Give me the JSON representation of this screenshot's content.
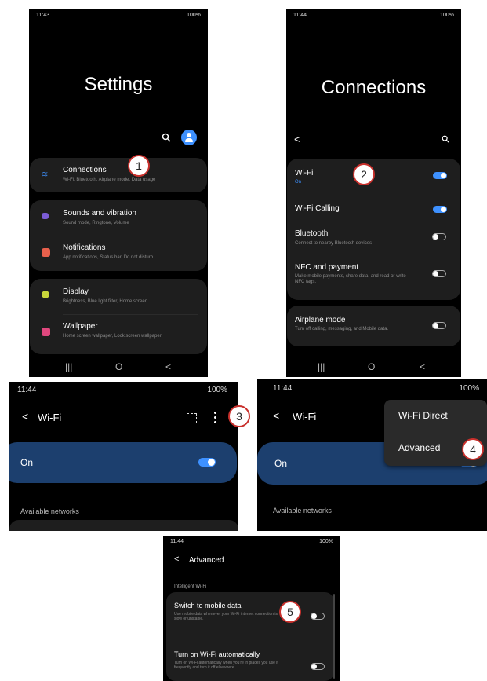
{
  "status": {
    "time_1": "11:43",
    "time_2": "11:44",
    "time_3": "11:44",
    "time_4": "11:44",
    "time_5": "11:44",
    "right": "100%"
  },
  "callouts": [
    "1",
    "2",
    "3",
    "4",
    "5"
  ],
  "nav": {
    "recents": "|||",
    "home": "O",
    "back": "<"
  },
  "settings": {
    "title": "Settings",
    "items": [
      {
        "label": "Connections",
        "sub": "Wi-Fi, Bluetooth, Airplane mode, Data usage"
      },
      {
        "label": "Sounds and vibration",
        "sub": "Sound mode, Ringtone, Volume"
      },
      {
        "label": "Notifications",
        "sub": "App notifications, Status bar, Do not disturb"
      },
      {
        "label": "Display",
        "sub": "Brightness, Blue light filter, Home screen"
      },
      {
        "label": "Wallpaper",
        "sub": "Home screen wallpaper, Lock screen wallpaper"
      }
    ]
  },
  "connections": {
    "title": "Connections",
    "back": "<",
    "items": [
      {
        "label": "Wi-Fi",
        "sub": "On",
        "on": true
      },
      {
        "label": "Wi-Fi Calling",
        "sub": "",
        "on": true
      },
      {
        "label": "Bluetooth",
        "sub": "Connect to nearby Bluetooth devices",
        "on": false
      },
      {
        "label": "NFC and payment",
        "sub": "Make mobile payments, share data, and read or write NFC tags.",
        "on": false
      },
      {
        "label": "Airplane mode",
        "sub": "Turn off calling, messaging, and Mobile data.",
        "on": false
      }
    ]
  },
  "wifi": {
    "back": "<",
    "title": "Wi-Fi",
    "state": "On",
    "section": "Available networks",
    "menu": [
      "Wi-Fi Direct",
      "Advanced"
    ]
  },
  "advanced": {
    "back": "<",
    "title": "Advanced",
    "section": "Intelligent Wi-Fi",
    "items": [
      {
        "label": "Switch to mobile data",
        "sub": "Use mobile data whenever your Wi-Fi internet connection is slow or unstable."
      },
      {
        "label": "Turn on Wi-Fi automatically",
        "sub": "Turn on Wi-Fi automatically when you're in places you use it frequently and turn it off elsewhere."
      }
    ]
  }
}
